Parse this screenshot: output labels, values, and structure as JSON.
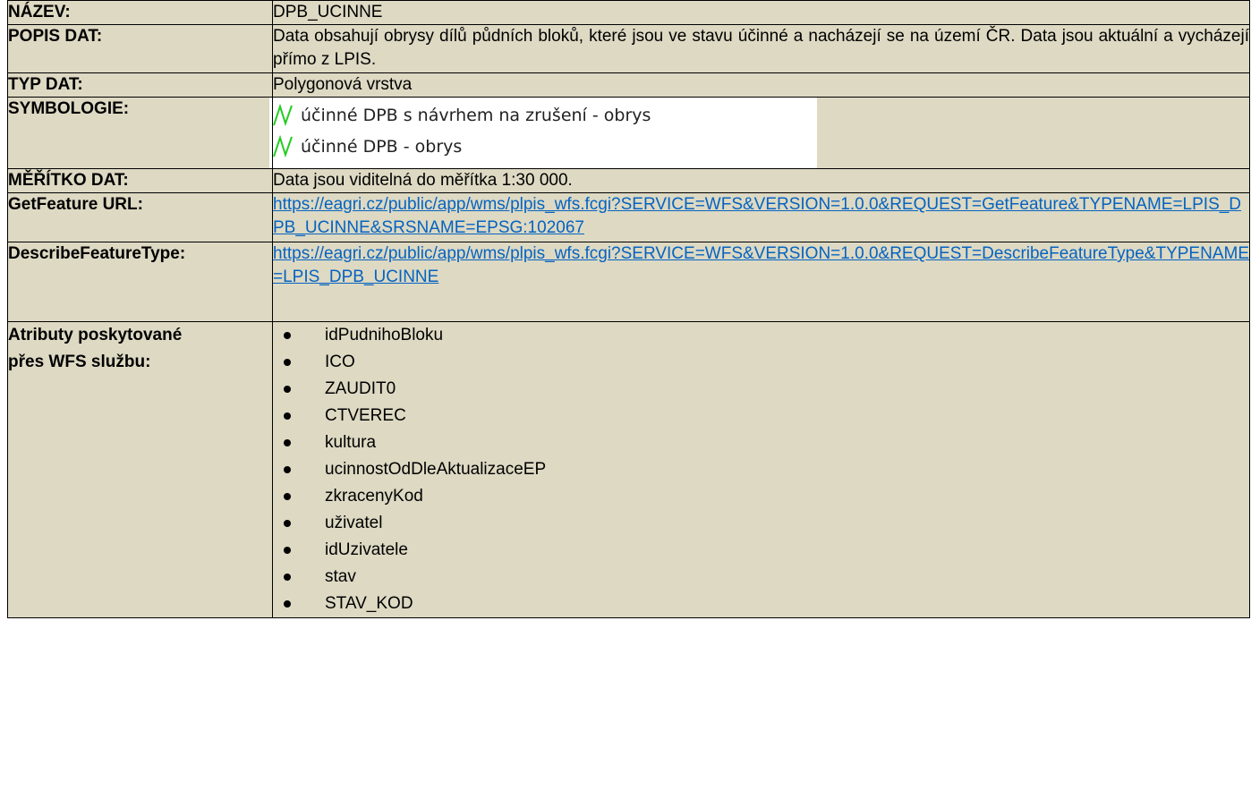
{
  "rows": {
    "name": {
      "label": "NÁZEV:",
      "value": "DPB_UCINNE"
    },
    "description": {
      "label": "POPIS DAT:",
      "value": "Data obsahují obrysy dílů půdních bloků, které jsou ve stavu účinné a nacházejí se na území ČR. Data jsou aktuální a vycházejí přímo z LPIS."
    },
    "data_type": {
      "label": "TYP DAT:",
      "value": "Polygonová vrstva"
    },
    "symbology": {
      "label": "SYMBOLOGIE:",
      "items": [
        {
          "icon": "green-zigzag-line-icon",
          "color": "#22cc22",
          "text": "účinné DPB s návrhem na zrušení - obrys"
        },
        {
          "icon": "green-zigzag-line-icon",
          "color": "#22cc22",
          "text": "účinné DPB - obrys"
        }
      ]
    },
    "scale": {
      "label": "MĚŘÍTKO DAT:",
      "value": "Data jsou viditelná do měřítka 1:30 000."
    },
    "getfeature": {
      "label": "GetFeature URL:",
      "url": "https://eagri.cz/public/app/wms/plpis_wfs.fcgi?SERVICE=WFS&VERSION=1.0.0&REQUEST=GetFeature&TYPENAME=LPIS_DPB_UCINNE&SRSNAME=EPSG:102067"
    },
    "describe": {
      "label": "DescribeFeatureType:",
      "url": "https://eagri.cz/public/app/wms/plpis_wfs.fcgi?SERVICE=WFS&VERSION=1.0.0&REQUEST=DescribeFeatureType&TYPENAME=LPIS_DPB_UCINNE"
    },
    "attributes": {
      "label_line1": "Atributy poskytované",
      "label_line2": "přes WFS službu:",
      "items": [
        "idPudnihoBloku",
        "ICO",
        "ZAUDIT0",
        "CTVEREC",
        "kultura",
        "ucinnostOdDleAktualizaceEP",
        "zkracenyKod",
        "uživatel",
        "idUzivatele",
        "stav",
        "STAV_KOD"
      ]
    }
  },
  "colors": {
    "cell_background": "#ddd9c3",
    "link": "#0563c1",
    "symbol_line": "#22cc22"
  }
}
